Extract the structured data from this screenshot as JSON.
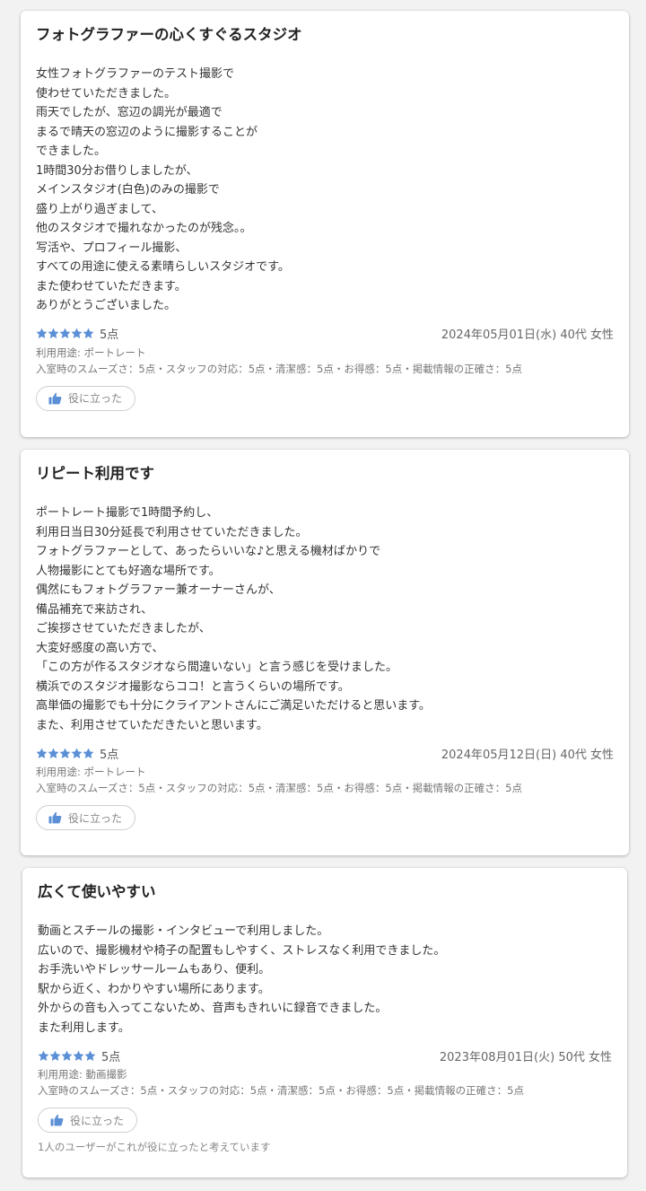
{
  "colors": {
    "star": "#5b8fd6",
    "thumb": "#5b8fd6"
  },
  "helpful_label": "役に立った",
  "reviews": [
    {
      "title": "フォトグラファーの心くすぐるスタジオ",
      "lines": [
        "女性フォトグラファーのテスト撮影で",
        "使わせていただきました。",
        "雨天でしたが、窓辺の調光が最適で",
        "まるで晴天の窓辺のように撮影することが",
        "できました。",
        "1時間30分お借りしましたが、",
        "メインスタジオ(白色)のみの撮影で",
        "盛り上がり過ぎまして、",
        "他のスタジオで撮れなかったのが残念。。",
        "写活や、プロフィール撮影、",
        "すべての用途に使える素晴らしいスタジオです。",
        "また使わせていただきます。",
        "ありがとうございました。"
      ],
      "stars": 5,
      "score": "5点",
      "date": "2024年05月01日(水) 40代 女性",
      "purpose": "利用用途: ポートレート",
      "detail": "入室時のスムーズさ：5点・スタッフの対応：5点・清潔感：5点・お得感：5点・掲載情報の正確さ：5点"
    },
    {
      "title": "リピート利用です",
      "lines": [
        "ポートレート撮影で1時間予約し、",
        "利用日当日30分延長で利用させていただきました。",
        "フォトグラファーとして、あったらいいな♪と思える機材ばかりで",
        "人物撮影にとても好適な場所です。",
        "偶然にもフォトグラファー兼オーナーさんが、",
        "備品補充で来訪され、",
        "ご挨拶させていただきましたが、",
        "大変好感度の高い方で、",
        "「この方が作るスタジオなら間違いない」と言う感じを受けました。",
        "横浜でのスタジオ撮影ならココ！と言うくらいの場所です。",
        "高単価の撮影でも十分にクライアントさんにご満足いただけると思います。",
        "また、利用させていただきたいと思います。"
      ],
      "stars": 5,
      "score": "5点",
      "date": "2024年05月12日(日) 40代 女性",
      "purpose": "利用用途: ポートレート",
      "detail": "入室時のスムーズさ：5点・スタッフの対応：5点・清潔感：5点・お得感：5点・掲載情報の正確さ：5点"
    },
    {
      "title": "広くて使いやすい",
      "lines": [
        "動画とスチールの撮影・インタビューで利用しました。",
        "広いので、撮影機材や椅子の配置もしやすく、ストレスなく利用できました。",
        "お手洗いやドレッサールームもあり、便利。",
        "駅から近く、わかりやすい場所にあります。",
        "外からの音も入ってこないため、音声もきれいに録音できました。",
        "また利用します。"
      ],
      "stars": 5,
      "score": "5点",
      "date": "2023年08月01日(火) 50代 女性",
      "purpose": "利用用途: 動画撮影",
      "detail": "入室時のスムーズさ：5点・スタッフの対応：5点・清潔感：5点・お得感：5点・掲載情報の正確さ：5点",
      "helpful_count": "1人のユーザーがこれが役に立ったと考えています"
    }
  ]
}
